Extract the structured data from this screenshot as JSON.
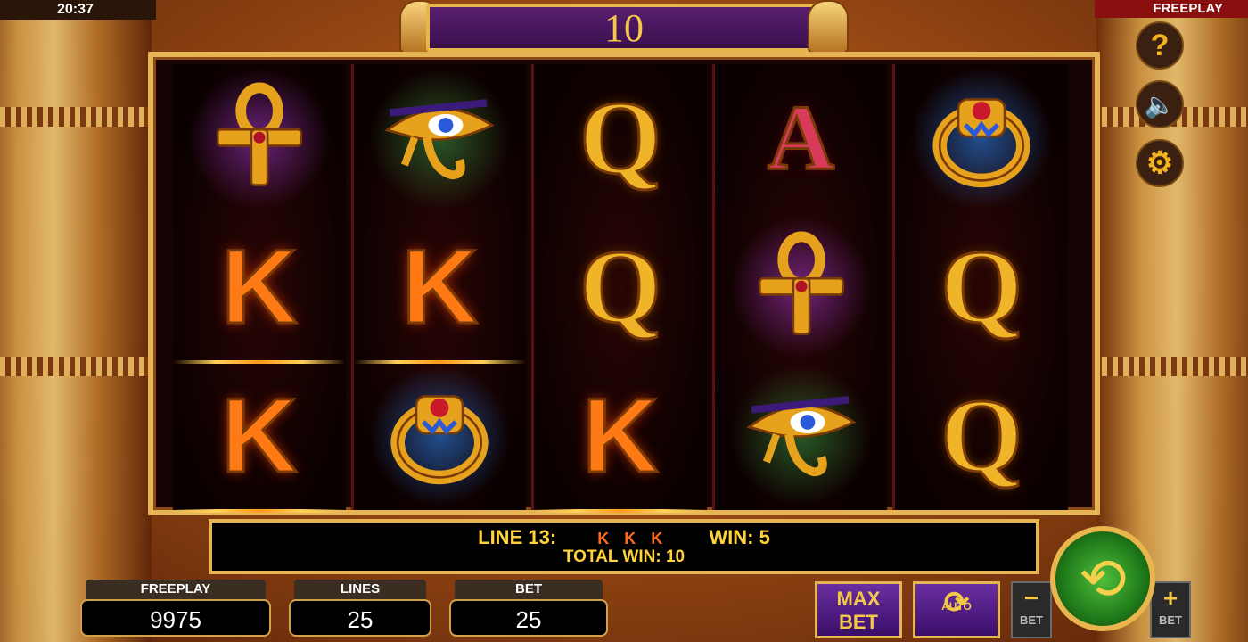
{
  "status": {
    "time": "20:37",
    "mode_label": "FREEPLAY"
  },
  "banner": {
    "number": "10"
  },
  "reels": [
    [
      {
        "symbol": "ankh",
        "glow": "purple"
      },
      {
        "symbol": "K"
      },
      {
        "symbol": "K"
      }
    ],
    [
      {
        "symbol": "eye-of-horus",
        "glow": "green"
      },
      {
        "symbol": "K"
      },
      {
        "symbol": "ring",
        "glow": "blue"
      }
    ],
    [
      {
        "symbol": "Q"
      },
      {
        "symbol": "Q"
      },
      {
        "symbol": "K"
      }
    ],
    [
      {
        "symbol": "A"
      },
      {
        "symbol": "ankh",
        "glow": "purple"
      },
      {
        "symbol": "eye-of-horus",
        "glow": "green"
      }
    ],
    [
      {
        "symbol": "ring",
        "glow": "blue"
      },
      {
        "symbol": "Q"
      },
      {
        "symbol": "Q"
      }
    ]
  ],
  "side_buttons": [
    {
      "name": "help-button",
      "icon": "question-icon",
      "glyph": "?"
    },
    {
      "name": "sound-button",
      "icon": "speaker-muted-icon",
      "glyph": "🔈"
    },
    {
      "name": "settings-button",
      "icon": "gear-icon",
      "glyph": "⚙"
    }
  ],
  "win_info": {
    "line_label": "LINE 13:",
    "line_symbols": "K K K",
    "win_label": "WIN: 5",
    "total_win_label": "TOTAL WIN: 10"
  },
  "stats": {
    "freeplay": {
      "label": "FREEPLAY",
      "value": "9975"
    },
    "lines": {
      "label": "LINES",
      "value": "25"
    },
    "bet": {
      "label": "BET",
      "value": "25"
    }
  },
  "controls": {
    "max_bet_line1": "MAX",
    "max_bet_line2": "BET",
    "auto_label": "AUTO",
    "bet_minus_sign": "−",
    "bet_minus_label": "BET",
    "bet_plus_sign": "+",
    "bet_plus_label": "BET"
  },
  "colors": {
    "accent_gold": "#e7b455",
    "panel_purple": "#4a1866",
    "spin_green": "#2f9a28"
  }
}
